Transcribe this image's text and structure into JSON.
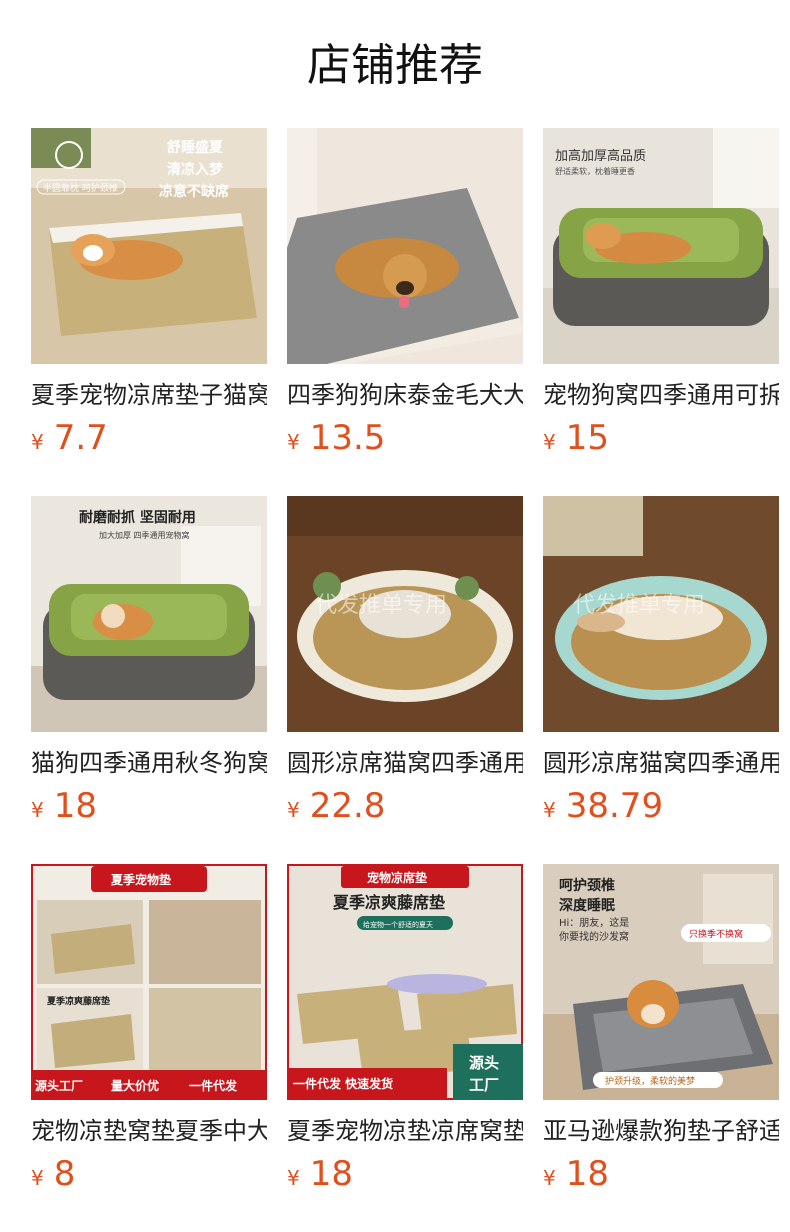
{
  "page": {
    "title": "店铺推荐"
  },
  "products": [
    {
      "name": "夏季宠物凉席垫子猫窝",
      "currency": "¥",
      "price": "7.7",
      "img_text": [
        "舒睡盛夏",
        "清凉入梦",
        "凉意不缺席",
        "半圆靠枕 呵护颈椎"
      ],
      "img_bg": "#c9b08c"
    },
    {
      "name": "四季狗狗床泰金毛犬大",
      "currency": "¥",
      "price": "13.5",
      "img_text": [],
      "img_bg": "#efe6dc"
    },
    {
      "name": "宠物狗窝四季通用可拆",
      "currency": "¥",
      "price": "15",
      "img_text": [
        "加高加厚高品质",
        "舒适柔软，枕着睡更香"
      ],
      "img_bg": "#e9e6df"
    },
    {
      "name": "猫狗四季通用秋冬狗窝",
      "currency": "¥",
      "price": "18",
      "img_text": [
        "耐磨耐抓 坚固耐用",
        "加大加厚 四季通用宠物窝"
      ],
      "img_bg": "#eeeae3"
    },
    {
      "name": "圆形凉席猫窝四季通用",
      "currency": "¥",
      "price": "22.8",
      "img_text": [
        "代发推单专用"
      ],
      "img_bg": "#6b4428"
    },
    {
      "name": "圆形凉席猫窝四季通用",
      "currency": "¥",
      "price": "38.79",
      "img_text": [
        "代发推单专用"
      ],
      "img_bg": "#6f4a2c"
    },
    {
      "name": "宠物凉垫窝垫夏季中大",
      "currency": "¥",
      "price": "8",
      "img_text": [
        "夏季宠物垫",
        "夏季凉爽藤席垫",
        "源头工厂",
        "量大价优",
        "一件代发"
      ],
      "img_bg": "#f1ece4"
    },
    {
      "name": "夏季宠物凉垫凉席窝垫",
      "currency": "¥",
      "price": "18",
      "img_text": [
        "宠物凉席垫",
        "夏季凉爽藤席垫",
        "给宠物一个舒适的夏天",
        "一件代发 快速发货",
        "源头",
        "工厂"
      ],
      "img_bg": "#e8e2d8"
    },
    {
      "name": "亚马逊爆款狗垫子舒适",
      "currency": "¥",
      "price": "18",
      "img_text": [
        "呵护颈椎",
        "深度睡眠",
        "Hi：朋友，这是",
        "你要找的沙发窝",
        "只换季不换窝",
        "护颈升级，柔软的美梦"
      ],
      "img_bg": "#d9cdbd"
    }
  ],
  "colors": {
    "price": "#e0501f",
    "title": "#111111"
  },
  "icons": [
    "snowflake-icon"
  ]
}
